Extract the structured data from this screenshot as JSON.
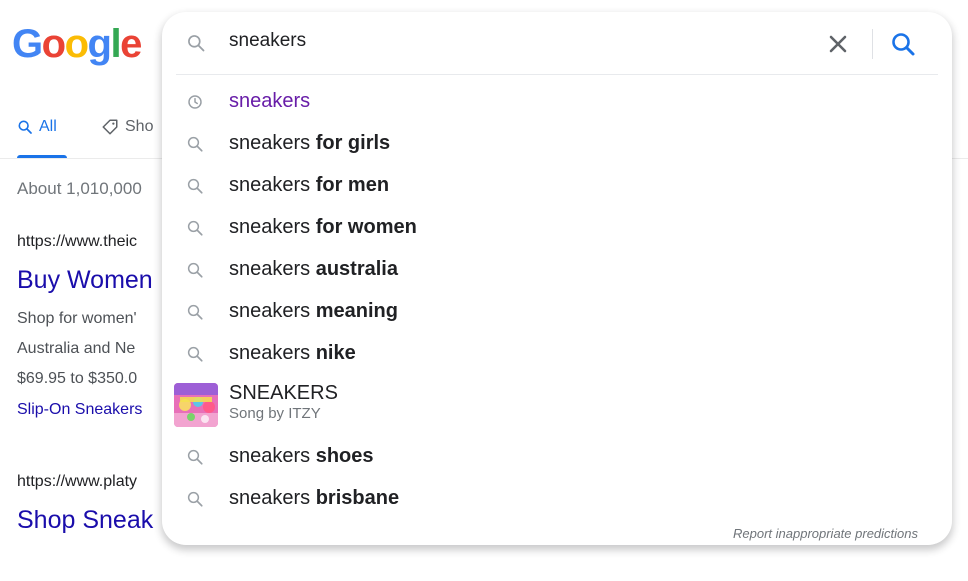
{
  "logo": {
    "letters": [
      "G",
      "o",
      "o",
      "g",
      "l",
      "e"
    ],
    "colors": [
      "#4285F4",
      "#EA4335",
      "#FBBC05",
      "#4285F4",
      "#34A853",
      "#EA4335"
    ]
  },
  "tabs": [
    {
      "label": "All",
      "icon": "search-icon",
      "active": true
    },
    {
      "label": "Sho",
      "icon": "tag-icon",
      "active": false
    }
  ],
  "results": {
    "stats": "About 1,010,000",
    "items": [
      {
        "url": "https://www.theic",
        "title": "Buy Women",
        "snippet": [
          "Shop for women'",
          "Australia and Ne",
          "$69.95 to $350.0"
        ],
        "sitelinks": "Slip-On Sneakers"
      },
      {
        "url": "https://www.platy",
        "title": "Shop Sneak"
      }
    ]
  },
  "search": {
    "query": "sneakers",
    "clear_icon": "close-icon",
    "submit_icon": "search-icon",
    "accent": "#1a73e8"
  },
  "suggestions": [
    {
      "type": "history",
      "icon": "clock-icon",
      "prefix": "sneakers",
      "suffix": ""
    },
    {
      "type": "search",
      "icon": "search-icon",
      "prefix": "sneakers ",
      "suffix": "for girls"
    },
    {
      "type": "search",
      "icon": "search-icon",
      "prefix": "sneakers ",
      "suffix": "for men"
    },
    {
      "type": "search",
      "icon": "search-icon",
      "prefix": "sneakers ",
      "suffix": "for women"
    },
    {
      "type": "search",
      "icon": "search-icon",
      "prefix": "sneakers ",
      "suffix": "australia"
    },
    {
      "type": "search",
      "icon": "search-icon",
      "prefix": "sneakers ",
      "suffix": "meaning"
    },
    {
      "type": "search",
      "icon": "search-icon",
      "prefix": "sneakers ",
      "suffix": "nike"
    },
    {
      "type": "rich",
      "icon": "album-art-thumbnail",
      "title": "SNEAKERS",
      "subtitle": "Song by ITZY"
    },
    {
      "type": "search",
      "icon": "search-icon",
      "prefix": "sneakers ",
      "suffix": "shoes"
    },
    {
      "type": "search",
      "icon": "search-icon",
      "prefix": "sneakers ",
      "suffix": "brisbane"
    }
  ],
  "report_link": "Report inappropriate predictions"
}
